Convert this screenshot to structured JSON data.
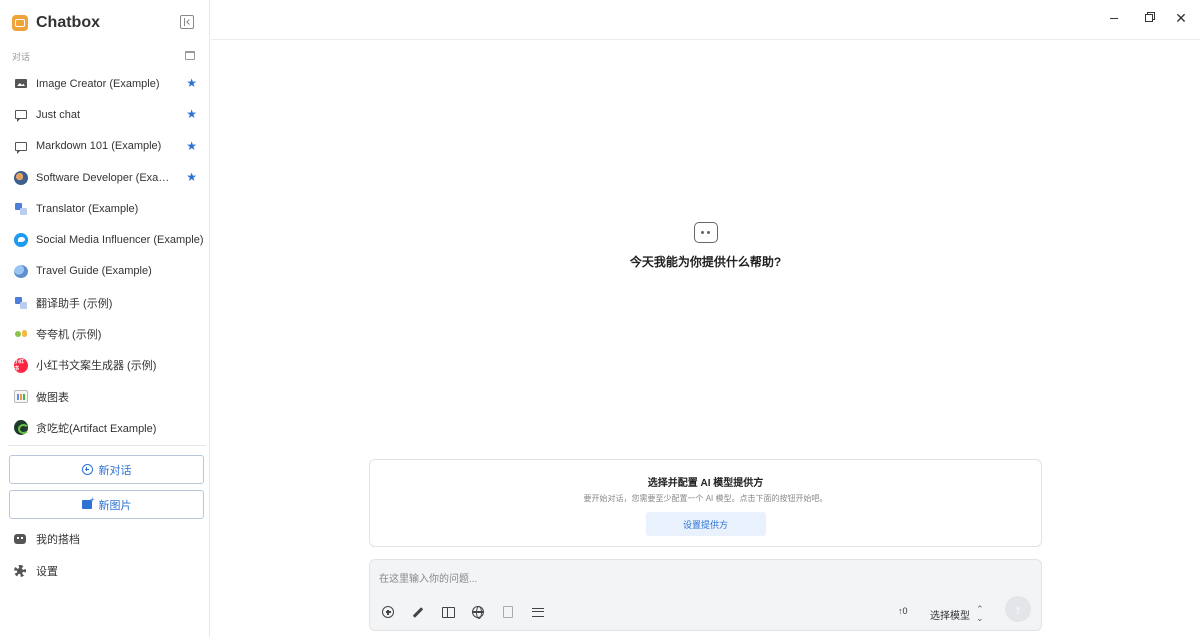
{
  "app": {
    "name": "Chatbox"
  },
  "sidebar": {
    "section_label": "对话",
    "conversations": [
      {
        "label": "Image Creator (Example)",
        "icon": "image-icon",
        "starred": true
      },
      {
        "label": "Just chat",
        "icon": "chat-bubble-icon",
        "starred": true
      },
      {
        "label": "Markdown 101 (Example)",
        "icon": "chat-bubble-icon",
        "starred": true
      },
      {
        "label": "Software Developer (Example)",
        "icon": "developer-avatar-icon",
        "starred": true
      },
      {
        "label": "Translator (Example)",
        "icon": "translator-avatar-icon",
        "starred": false
      },
      {
        "label": "Social Media Influencer (Example)",
        "icon": "twitter-avatar-icon",
        "starred": false
      },
      {
        "label": "Travel Guide (Example)",
        "icon": "travel-avatar-icon",
        "starred": false
      },
      {
        "label": "翻译助手 (示例)",
        "icon": "translator-avatar-icon",
        "starred": false
      },
      {
        "label": "夸夸机 (示例)",
        "icon": "fortune-avatar-icon",
        "starred": false
      },
      {
        "label": "小红书文案生成器 (示例)",
        "icon": "xiaohongshu-avatar-icon",
        "starred": false
      },
      {
        "label": "做图表",
        "icon": "chart-avatar-icon",
        "starred": false
      },
      {
        "label": "贪吃蛇(Artifact Example)",
        "icon": "snake-avatar-icon",
        "starred": false
      }
    ],
    "xhs_icon_text": "小红书",
    "new_chat_label": "新对话",
    "new_image_label": "新图片",
    "copilots_label": "我的搭档",
    "settings_label": "设置"
  },
  "main": {
    "empty_title": "今天我能为你提供什么帮助?",
    "provider_card": {
      "title": "选择并配置 AI 模型提供方",
      "description": "要开始对话，您需要至少配置一个 AI 模型。点击下面的按钮开始吧。",
      "button_label": "设置提供方"
    },
    "input": {
      "placeholder": "在这里输入你的问题...",
      "value": ""
    },
    "token_count": "↑0",
    "model_select_label": "选择模型"
  },
  "colors": {
    "accent": "#2d73d6",
    "star": "#2d73d6",
    "send_disabled": "#e3e5e8"
  }
}
